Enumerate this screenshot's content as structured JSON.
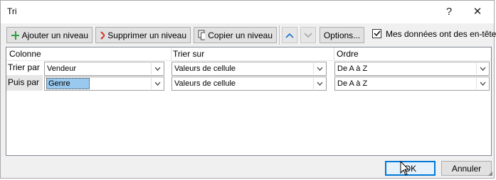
{
  "window": {
    "title": "Tri",
    "help_label": "?",
    "close_label": "✕"
  },
  "toolbar": {
    "add_level": "Ajouter un niveau",
    "delete_level": "Supprimer un niveau",
    "copy_level": "Copier un niveau",
    "options": "Options...",
    "headers_checkbox_label": "Mes données ont des en-têtes",
    "headers_checked": true
  },
  "grid": {
    "headers": {
      "column": "Colonne",
      "sort_on": "Trier sur",
      "order": "Ordre"
    },
    "rows": [
      {
        "label": "Trier par",
        "column": "Vendeur",
        "sort_on": "Valeurs de cellule",
        "order": "De A à Z"
      },
      {
        "label": "Puis par",
        "column": "Genre",
        "sort_on": "Valeurs de cellule",
        "order": "De A à Z"
      }
    ]
  },
  "footer": {
    "ok": "OK",
    "cancel": "Annuler"
  },
  "colors": {
    "accent": "#0078d7",
    "selection": "#99c9ef",
    "add_icon": "#2e9e3e",
    "delete_icon": "#d93025"
  }
}
